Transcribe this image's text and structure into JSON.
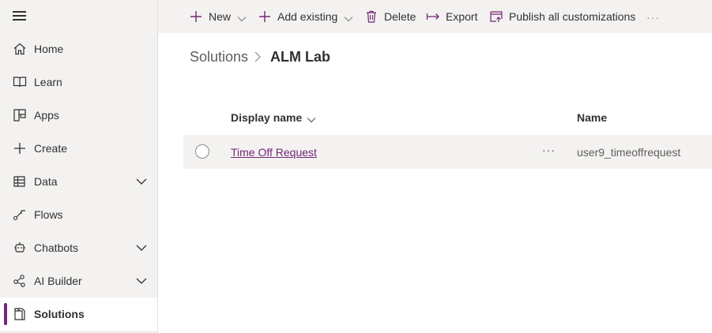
{
  "sidebar": {
    "items": [
      {
        "label": "Home",
        "icon": "home-icon",
        "expandable": false,
        "selected": false
      },
      {
        "label": "Learn",
        "icon": "book-icon",
        "expandable": false,
        "selected": false
      },
      {
        "label": "Apps",
        "icon": "apps-icon",
        "expandable": false,
        "selected": false
      },
      {
        "label": "Create",
        "icon": "plus-icon",
        "expandable": false,
        "selected": false
      },
      {
        "label": "Data",
        "icon": "table-icon",
        "expandable": true,
        "selected": false
      },
      {
        "label": "Flows",
        "icon": "flow-icon",
        "expandable": false,
        "selected": false
      },
      {
        "label": "Chatbots",
        "icon": "bot-icon",
        "expandable": true,
        "selected": false
      },
      {
        "label": "AI Builder",
        "icon": "ai-builder-icon",
        "expandable": true,
        "selected": false
      },
      {
        "label": "Solutions",
        "icon": "solutions-icon",
        "expandable": false,
        "selected": true
      }
    ]
  },
  "commandbar": {
    "new_label": "New",
    "add_existing_label": "Add existing",
    "delete_label": "Delete",
    "export_label": "Export",
    "publish_label": "Publish all customizations",
    "more_label": "···"
  },
  "breadcrumb": {
    "root": "Solutions",
    "current": "ALM Lab"
  },
  "table": {
    "headers": {
      "display_name": "Display name",
      "name": "Name"
    },
    "rows": [
      {
        "display_name": "Time Off Request",
        "more": "···",
        "name": "user9_timeoffrequest"
      }
    ]
  },
  "colors": {
    "accent": "#742774",
    "sidebar_bg": "#f3f2f1",
    "text": "#323130"
  }
}
